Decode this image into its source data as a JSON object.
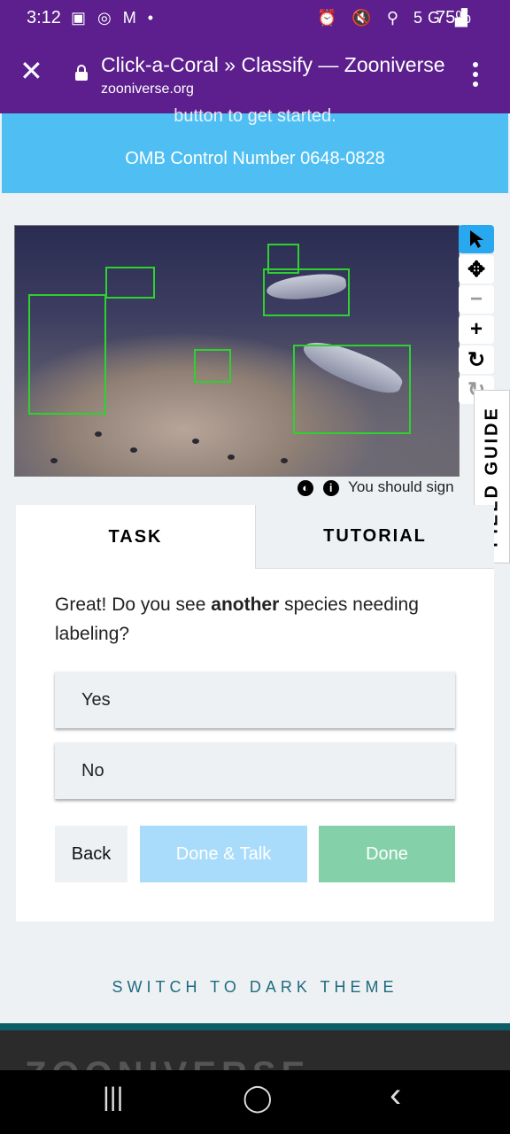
{
  "status_bar": {
    "time": "3:12",
    "left_icons": "▣ ◎ M •",
    "right_icons": "⏰ 🔇 ⚲ 5G ▟",
    "battery": "75%"
  },
  "browser": {
    "close_icon": "✕",
    "title": "Click-a-Coral » Classify — Zooniverse",
    "domain": "zooniverse.org"
  },
  "banner": {
    "cutoff_text": "button to get started.",
    "omb": "OMB Control Number 0648-0828"
  },
  "viewer": {
    "tools": [
      "pointer-icon",
      "move-icon",
      "zoom-out-icon",
      "zoom-in-icon",
      "rotate-icon",
      "reset-icon"
    ]
  },
  "meta": {
    "contrast_icon": "◐",
    "info_icon": "i",
    "text": "You should sign"
  },
  "field_guide": {
    "label": "FIELD GUIDE"
  },
  "tabs": {
    "task": "TASK",
    "tutorial": "TUTORIAL"
  },
  "task": {
    "question_pre": "Great! Do you see ",
    "question_bold": "another",
    "question_post": " species needing labeling?",
    "answers": [
      "Yes",
      "No"
    ],
    "back": "Back",
    "done_talk": "Done & Talk",
    "done": "Done"
  },
  "theme": {
    "switch_label": "SWITCH TO DARK THEME"
  },
  "footer": {
    "logo": "ZOONIVERSE"
  },
  "nav": {
    "recents": "|||",
    "home": "◯",
    "back": "‹"
  }
}
